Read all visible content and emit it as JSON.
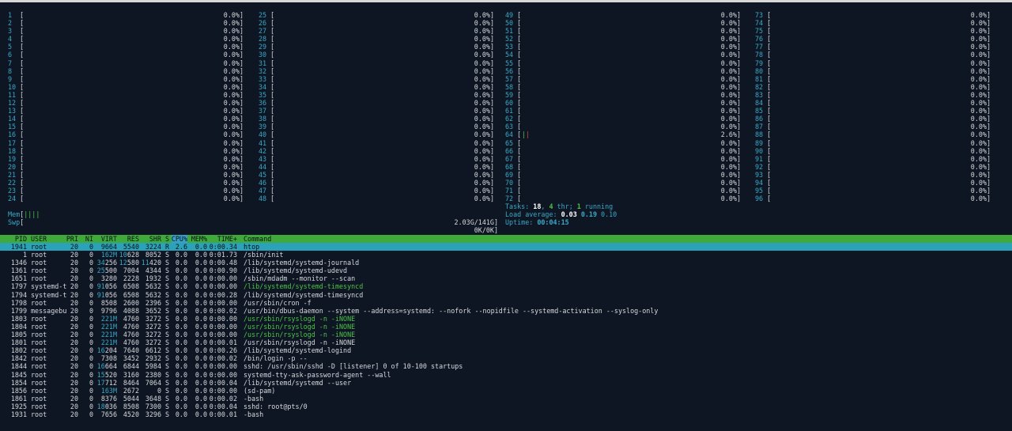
{
  "cpus_left_cols": [
    {
      "start": 1,
      "rows": [
        {
          "n": "1",
          "pct": "0.0%"
        },
        {
          "n": "2",
          "pct": "0.0%"
        },
        {
          "n": "3",
          "pct": "0.0%"
        },
        {
          "n": "4",
          "pct": "0.0%"
        },
        {
          "n": "5",
          "pct": "0.0%"
        },
        {
          "n": "6",
          "pct": "0.0%"
        },
        {
          "n": "7",
          "pct": "0.0%"
        },
        {
          "n": "8",
          "pct": "0.0%"
        },
        {
          "n": "9",
          "pct": "0.0%"
        },
        {
          "n": "10",
          "pct": "0.0%"
        },
        {
          "n": "11",
          "pct": "0.0%"
        },
        {
          "n": "12",
          "pct": "0.0%"
        },
        {
          "n": "13",
          "pct": "0.0%"
        },
        {
          "n": "14",
          "pct": "0.0%"
        },
        {
          "n": "15",
          "pct": "0.0%"
        },
        {
          "n": "16",
          "pct": "0.0%"
        },
        {
          "n": "17",
          "pct": "0.0%"
        },
        {
          "n": "18",
          "pct": "0.0%"
        },
        {
          "n": "19",
          "pct": "0.0%"
        },
        {
          "n": "20",
          "pct": "0.0%"
        },
        {
          "n": "21",
          "pct": "0.0%"
        },
        {
          "n": "22",
          "pct": "0.0%"
        },
        {
          "n": "23",
          "pct": "0.0%"
        },
        {
          "n": "24",
          "pct": "0.0%"
        }
      ]
    },
    {
      "start": 25,
      "rows": [
        {
          "n": "25",
          "pct": "0.0%"
        },
        {
          "n": "26",
          "pct": "0.0%"
        },
        {
          "n": "27",
          "pct": "0.0%"
        },
        {
          "n": "28",
          "pct": "0.0%"
        },
        {
          "n": "29",
          "pct": "0.0%"
        },
        {
          "n": "30",
          "pct": "0.0%"
        },
        {
          "n": "31",
          "pct": "0.0%"
        },
        {
          "n": "32",
          "pct": "0.0%"
        },
        {
          "n": "33",
          "pct": "0.0%"
        },
        {
          "n": "34",
          "pct": "0.0%"
        },
        {
          "n": "35",
          "pct": "0.0%"
        },
        {
          "n": "36",
          "pct": "0.0%"
        },
        {
          "n": "37",
          "pct": "0.0%"
        },
        {
          "n": "38",
          "pct": "0.0%"
        },
        {
          "n": "39",
          "pct": "0.0%"
        },
        {
          "n": "40",
          "pct": "0.0%"
        },
        {
          "n": "41",
          "pct": "0.0%"
        },
        {
          "n": "42",
          "pct": "0.0%"
        },
        {
          "n": "43",
          "pct": "0.0%"
        },
        {
          "n": "44",
          "pct": "0.0%"
        },
        {
          "n": "45",
          "pct": "0.0%"
        },
        {
          "n": "46",
          "pct": "0.0%"
        },
        {
          "n": "47",
          "pct": "0.0%"
        },
        {
          "n": "48",
          "pct": "0.0%"
        }
      ]
    },
    {
      "start": 49,
      "rows": [
        {
          "n": "49",
          "pct": "0.0%"
        },
        {
          "n": "50",
          "pct": "0.0%"
        },
        {
          "n": "51",
          "pct": "0.0%"
        },
        {
          "n": "52",
          "pct": "0.0%"
        },
        {
          "n": "53",
          "pct": "0.0%"
        },
        {
          "n": "54",
          "pct": "0.0%"
        },
        {
          "n": "55",
          "pct": "0.0%"
        },
        {
          "n": "56",
          "pct": "0.0%"
        },
        {
          "n": "57",
          "pct": "0.0%"
        },
        {
          "n": "58",
          "pct": "0.0%"
        },
        {
          "n": "59",
          "pct": "0.0%"
        },
        {
          "n": "60",
          "pct": "0.0%"
        },
        {
          "n": "61",
          "pct": "0.0%"
        },
        {
          "n": "62",
          "pct": "0.0%"
        },
        {
          "n": "63",
          "pct": "0.0%"
        },
        {
          "n": "64",
          "pct": "2.6%",
          "bar": "||"
        },
        {
          "n": "65",
          "pct": "0.0%"
        },
        {
          "n": "66",
          "pct": "0.0%"
        },
        {
          "n": "67",
          "pct": "0.0%"
        },
        {
          "n": "68",
          "pct": "0.0%"
        },
        {
          "n": "69",
          "pct": "0.0%"
        },
        {
          "n": "70",
          "pct": "0.0%"
        },
        {
          "n": "71",
          "pct": "0.0%"
        },
        {
          "n": "72",
          "pct": "0.0%"
        }
      ]
    },
    {
      "start": 73,
      "rows": [
        {
          "n": "73",
          "pct": "0.0%"
        },
        {
          "n": "74",
          "pct": "0.0%"
        },
        {
          "n": "75",
          "pct": "0.0%"
        },
        {
          "n": "76",
          "pct": "0.0%"
        },
        {
          "n": "77",
          "pct": "0.0%"
        },
        {
          "n": "78",
          "pct": "0.0%"
        },
        {
          "n": "79",
          "pct": "0.0%"
        },
        {
          "n": "80",
          "pct": "0.0%"
        },
        {
          "n": "81",
          "pct": "0.0%"
        },
        {
          "n": "82",
          "pct": "0.0%"
        },
        {
          "n": "83",
          "pct": "0.0%"
        },
        {
          "n": "84",
          "pct": "0.0%"
        },
        {
          "n": "85",
          "pct": "0.0%"
        },
        {
          "n": "86",
          "pct": "0.0%"
        },
        {
          "n": "87",
          "pct": "0.0%"
        },
        {
          "n": "88",
          "pct": "0.0%"
        },
        {
          "n": "89",
          "pct": "0.0%"
        },
        {
          "n": "90",
          "pct": "0.0%"
        },
        {
          "n": "91",
          "pct": "0.0%"
        },
        {
          "n": "92",
          "pct": "0.0%"
        },
        {
          "n": "93",
          "pct": "0.0%"
        },
        {
          "n": "94",
          "pct": "0.0%"
        },
        {
          "n": "95",
          "pct": "0.0%"
        },
        {
          "n": "96",
          "pct": "0.0%"
        }
      ]
    }
  ],
  "memory": {
    "mem_label": "Mem",
    "mem_bar": "||||",
    "mem_value": "2.03G/141G",
    "swp_label": "Swp",
    "swp_value": "0K/0K"
  },
  "summary": {
    "tasks_label": "Tasks: ",
    "tasks": "18",
    "thr_sep": ", ",
    "thr": "4",
    "thr_label": " thr; ",
    "running": "1",
    "running_label": " running",
    "load_label": "Load average: ",
    "load1": "0.03",
    "load5": "0.19",
    "load15": "0.10",
    "uptime_label": "Uptime: ",
    "uptime": "00:04:15"
  },
  "columns": [
    "PID",
    "USER",
    "PRI",
    "NI",
    "VIRT",
    "RES",
    "SHR",
    "S",
    "CPU%",
    "MEM%",
    "TIME+",
    "Command"
  ],
  "sorted_column": "CPU%",
  "processes": [
    {
      "pid": "1941",
      "user": "root",
      "pri": "20",
      "ni": "0",
      "virt": "9664",
      "res": "5540",
      "shr": "3224",
      "s": "R",
      "cpu": "2.6",
      "mem": "0.0",
      "time": "0:00.34",
      "cmd": "htop",
      "selected": true
    },
    {
      "pid": "1",
      "user": "root",
      "pri": "20",
      "ni": "0",
      "virt": "162M",
      "res": "10628",
      "shr": "8052",
      "s": "S",
      "cpu": "0.0",
      "mem": "0.0",
      "time": "0:01.73",
      "cmd": "/sbin/init"
    },
    {
      "pid": "1346",
      "user": "root",
      "pri": "20",
      "ni": "0",
      "virt": "34256",
      "res": "12580",
      "shr": "11420",
      "s": "S",
      "cpu": "0.0",
      "mem": "0.0",
      "time": "0:00.48",
      "cmd": "/lib/systemd/systemd-journald"
    },
    {
      "pid": "1361",
      "user": "root",
      "pri": "20",
      "ni": "0",
      "virt": "25500",
      "res": "7004",
      "shr": "4344",
      "s": "S",
      "cpu": "0.0",
      "mem": "0.0",
      "time": "0:00.90",
      "cmd": "/lib/systemd/systemd-udevd"
    },
    {
      "pid": "1651",
      "user": "root",
      "pri": "20",
      "ni": "0",
      "virt": "3280",
      "res": "2228",
      "shr": "1932",
      "s": "S",
      "cpu": "0.0",
      "mem": "0.0",
      "time": "0:00.00",
      "cmd": "/sbin/mdadm --monitor --scan"
    },
    {
      "pid": "1797",
      "user": "systemd-t",
      "pri": "20",
      "ni": "0",
      "virt": "91056",
      "res": "6508",
      "shr": "5632",
      "s": "S",
      "cpu": "0.0",
      "mem": "0.0",
      "time": "0:00.00",
      "cmd": "/lib/systemd/systemd-timesyncd",
      "thread": true
    },
    {
      "pid": "1794",
      "user": "systemd-t",
      "pri": "20",
      "ni": "0",
      "virt": "91056",
      "res": "6508",
      "shr": "5632",
      "s": "S",
      "cpu": "0.0",
      "mem": "0.0",
      "time": "0:00.28",
      "cmd": "/lib/systemd/systemd-timesyncd"
    },
    {
      "pid": "1798",
      "user": "root",
      "pri": "20",
      "ni": "0",
      "virt": "8508",
      "res": "2600",
      "shr": "2396",
      "s": "S",
      "cpu": "0.0",
      "mem": "0.0",
      "time": "0:00.00",
      "cmd": "/usr/sbin/cron -f"
    },
    {
      "pid": "1799",
      "user": "messagebu",
      "pri": "20",
      "ni": "0",
      "virt": "9796",
      "res": "4088",
      "shr": "3652",
      "s": "S",
      "cpu": "0.0",
      "mem": "0.0",
      "time": "0:00.02",
      "cmd": "/usr/bin/dbus-daemon --system --address=systemd: --nofork --nopidfile --systemd-activation --syslog-only"
    },
    {
      "pid": "1803",
      "user": "root",
      "pri": "20",
      "ni": "0",
      "virt": "221M",
      "res": "4760",
      "shr": "3272",
      "s": "S",
      "cpu": "0.0",
      "mem": "0.0",
      "time": "0:00.00",
      "cmd": "/usr/sbin/rsyslogd -n -iNONE",
      "thread": true
    },
    {
      "pid": "1804",
      "user": "root",
      "pri": "20",
      "ni": "0",
      "virt": "221M",
      "res": "4760",
      "shr": "3272",
      "s": "S",
      "cpu": "0.0",
      "mem": "0.0",
      "time": "0:00.00",
      "cmd": "/usr/sbin/rsyslogd -n -iNONE",
      "thread": true
    },
    {
      "pid": "1805",
      "user": "root",
      "pri": "20",
      "ni": "0",
      "virt": "221M",
      "res": "4760",
      "shr": "3272",
      "s": "S",
      "cpu": "0.0",
      "mem": "0.0",
      "time": "0:00.00",
      "cmd": "/usr/sbin/rsyslogd -n -iNONE",
      "thread": true
    },
    {
      "pid": "1801",
      "user": "root",
      "pri": "20",
      "ni": "0",
      "virt": "221M",
      "res": "4760",
      "shr": "3272",
      "s": "S",
      "cpu": "0.0",
      "mem": "0.0",
      "time": "0:00.01",
      "cmd": "/usr/sbin/rsyslogd -n -iNONE"
    },
    {
      "pid": "1802",
      "user": "root",
      "pri": "20",
      "ni": "0",
      "virt": "16204",
      "res": "7640",
      "shr": "6612",
      "s": "S",
      "cpu": "0.0",
      "mem": "0.0",
      "time": "0:00.26",
      "cmd": "/lib/systemd/systemd-logind"
    },
    {
      "pid": "1842",
      "user": "root",
      "pri": "20",
      "ni": "0",
      "virt": "7308",
      "res": "3452",
      "shr": "2932",
      "s": "S",
      "cpu": "0.0",
      "mem": "0.0",
      "time": "0:00.02",
      "cmd": "/bin/login -p --"
    },
    {
      "pid": "1844",
      "user": "root",
      "pri": "20",
      "ni": "0",
      "virt": "16664",
      "res": "6844",
      "shr": "5984",
      "s": "S",
      "cpu": "0.0",
      "mem": "0.0",
      "time": "0:00.00",
      "cmd": "sshd: /usr/sbin/sshd -D [listener] 0 of 10-100 startups"
    },
    {
      "pid": "1845",
      "user": "root",
      "pri": "20",
      "ni": "0",
      "virt": "15520",
      "res": "3160",
      "shr": "2380",
      "s": "S",
      "cpu": "0.0",
      "mem": "0.0",
      "time": "0:00.00",
      "cmd": "systemd-tty-ask-password-agent --wall"
    },
    {
      "pid": "1854",
      "user": "root",
      "pri": "20",
      "ni": "0",
      "virt": "17712",
      "res": "8464",
      "shr": "7064",
      "s": "S",
      "cpu": "0.0",
      "mem": "0.0",
      "time": "0:00.04",
      "cmd": "/lib/systemd/systemd --user"
    },
    {
      "pid": "1856",
      "user": "root",
      "pri": "20",
      "ni": "0",
      "virt": "163M",
      "res": "2672",
      "shr": "0",
      "s": "S",
      "cpu": "0.0",
      "mem": "0.0",
      "time": "0:00.00",
      "cmd": "(sd-pam)"
    },
    {
      "pid": "1861",
      "user": "root",
      "pri": "20",
      "ni": "0",
      "virt": "8376",
      "res": "5044",
      "shr": "3648",
      "s": "S",
      "cpu": "0.0",
      "mem": "0.0",
      "time": "0:00.02",
      "cmd": "-bash"
    },
    {
      "pid": "1925",
      "user": "root",
      "pri": "20",
      "ni": "0",
      "virt": "18036",
      "res": "8508",
      "shr": "7300",
      "s": "S",
      "cpu": "0.0",
      "mem": "0.0",
      "time": "0:00.04",
      "cmd": "sshd: root@pts/0"
    },
    {
      "pid": "1931",
      "user": "root",
      "pri": "20",
      "ni": "0",
      "virt": "7656",
      "res": "4520",
      "shr": "3296",
      "s": "S",
      "cpu": "0.0",
      "mem": "0.0",
      "time": "0:00.01",
      "cmd": "-bash"
    }
  ]
}
